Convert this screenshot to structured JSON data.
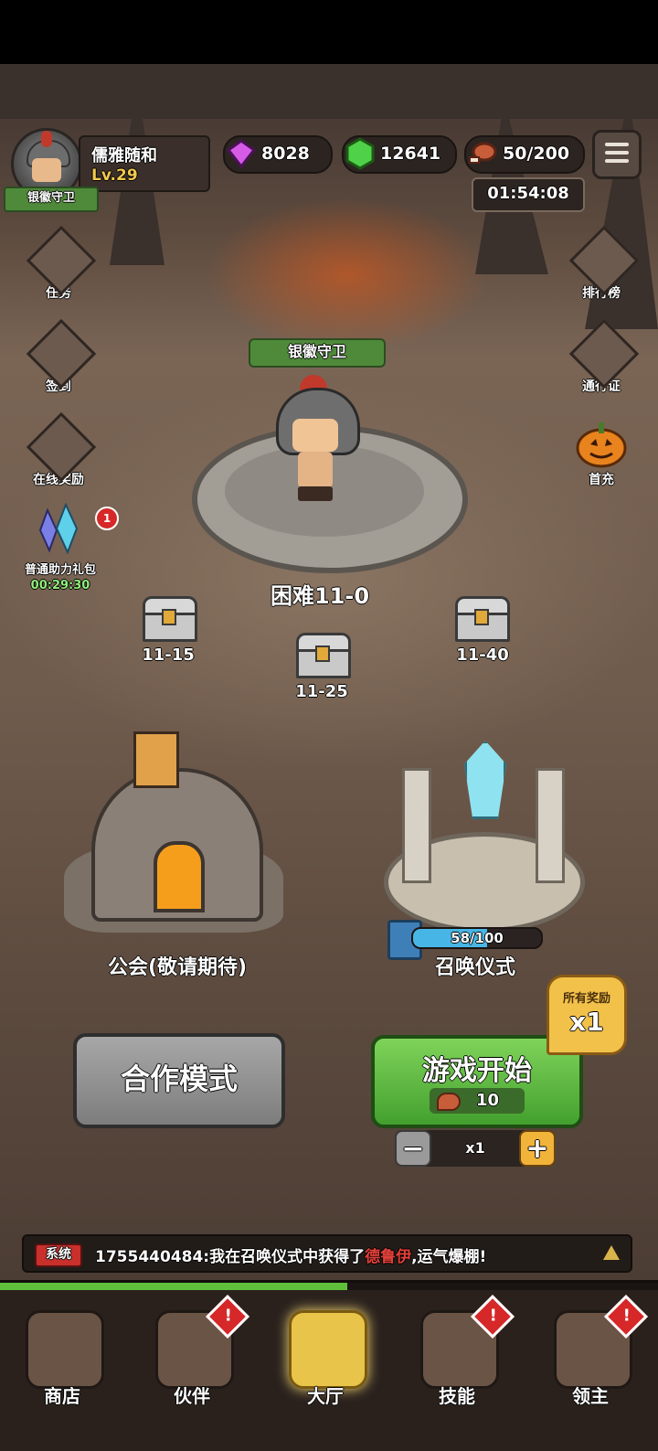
{
  "player": {
    "name": "儒雅随和",
    "level": "Lv.29",
    "title": "银徽守卫"
  },
  "resources": {
    "gems": "8028",
    "emeralds": "12641",
    "stamina": "50/200"
  },
  "timer": "01:54:08",
  "left_menu": [
    {
      "label": "任务",
      "icon": "scroll-sword-icon"
    },
    {
      "label": "签到",
      "icon": "checklist-icon"
    },
    {
      "label": "在线奖励",
      "icon": "coin-pile-icon"
    },
    {
      "label": "普通助力礼包",
      "icon": "crystal-pack-icon",
      "badge": "1",
      "timer": "00:29:30"
    }
  ],
  "right_menu": [
    {
      "label": "排行榜",
      "icon": "leaderboard-scroll-icon"
    },
    {
      "label": "通行证",
      "icon": "pass-badge-icon"
    },
    {
      "label": "首充",
      "icon": "pumpkin-icon"
    }
  ],
  "stage": {
    "hero_title": "银徽守卫",
    "label": "困难11-0"
  },
  "chests": [
    "11-15",
    "11-25",
    "11-40"
  ],
  "buildings": {
    "guild": "公会(敬请期待)",
    "summon": "召唤仪式",
    "summon_progress": "58/100",
    "summon_fraction": 0.58
  },
  "buttons": {
    "coop": "合作模式",
    "start": "游戏开始",
    "start_cost": "10",
    "bonus_title": "所有奖励",
    "bonus_value": "x1",
    "multiplier": "x1",
    "minus": "−",
    "plus": "+"
  },
  "news": {
    "tag": "系统",
    "prefix": "1755440484:我在召唤仪式中获得了",
    "highlight": "德鲁伊",
    "suffix": ",运气爆棚!"
  },
  "nav": [
    {
      "label": "商店",
      "icon": "shop-icon",
      "alert": false
    },
    {
      "label": "伙伴",
      "icon": "hooded-partner-icon",
      "alert": true
    },
    {
      "label": "大厅",
      "icon": "hall-icon",
      "alert": false,
      "active": true
    },
    {
      "label": "技能",
      "icon": "skill-book-icon",
      "alert": true
    },
    {
      "label": "领主",
      "icon": "lord-helmet-icon",
      "alert": true
    }
  ],
  "alert_mark": "!",
  "colors": {
    "accent_green": "#43a02e",
    "alert_red": "#d62828",
    "gold": "#f2c14a"
  }
}
